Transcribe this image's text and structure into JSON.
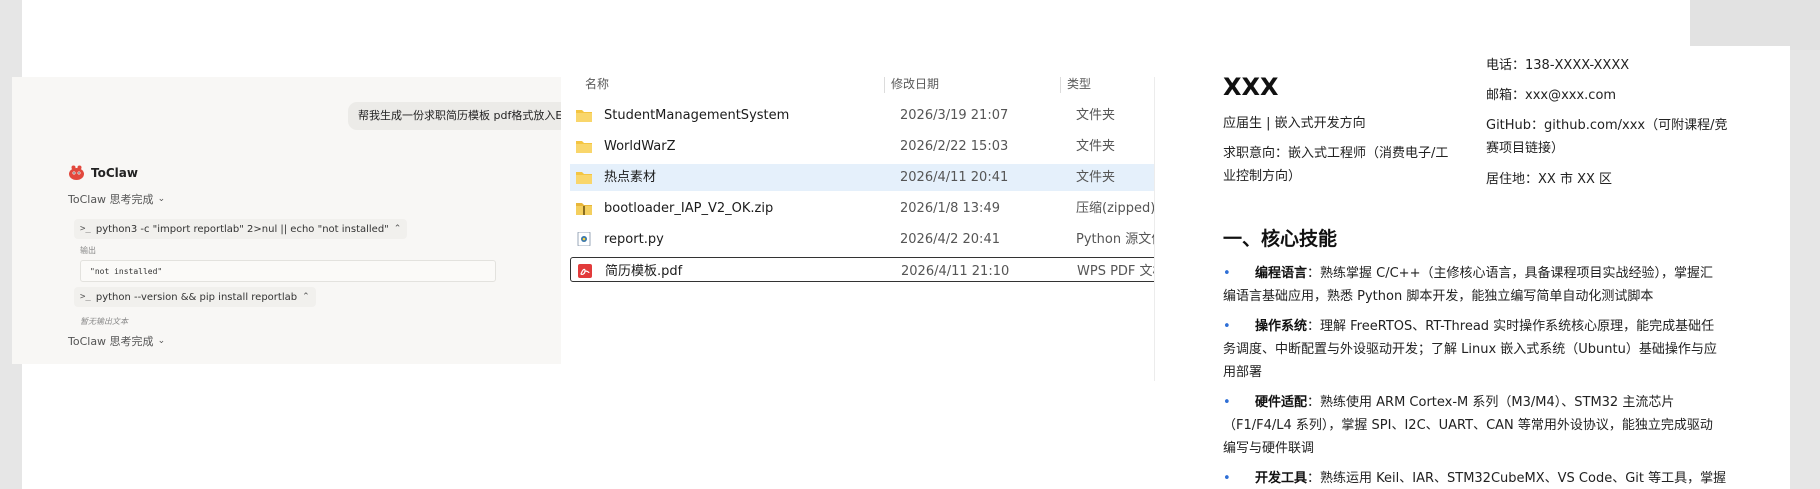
{
  "chat": {
    "user_message": "帮我生成一份求职简历模板 pdf格式放入E盘",
    "bot_name": "ToClaw",
    "think_done_1": "ToClaw 思考完成",
    "cmd1": "python3 -c \"import reportlab\" 2>nul || echo \"not installed\"",
    "output_label": "输出",
    "output_value": "\"not installed\"",
    "cmd2": "python --version && pip install reportlab",
    "no_output": "暂无输出文本",
    "think_done_2": "ToClaw 思考完成"
  },
  "explorer": {
    "headers": {
      "name": "名称",
      "date": "修改日期",
      "type": "类型"
    },
    "rows": [
      {
        "name": "StudentManagementSystem",
        "date": "2026/3/19 21:07",
        "type": "文件夹",
        "icon": "folder-icon"
      },
      {
        "name": "WorldWarZ",
        "date": "2026/2/22 15:03",
        "type": "文件夹",
        "icon": "folder-icon"
      },
      {
        "name": "热点素材",
        "date": "2026/4/11 20:41",
        "type": "文件夹",
        "icon": "folder-icon"
      },
      {
        "name": "bootloader_IAP_V2_OK.zip",
        "date": "2026/1/8 13:49",
        "type": "压缩(zipped)文",
        "icon": "zip-folder-icon"
      },
      {
        "name": "report.py",
        "date": "2026/4/2 20:41",
        "type": "Python 源文件",
        "icon": "python-file-icon"
      },
      {
        "name": "简历模板.pdf",
        "date": "2026/4/11 21:10",
        "type": "WPS PDF 文档",
        "icon": "pdf-file-icon"
      }
    ]
  },
  "resume": {
    "name": "XXX",
    "status": "应届生 | 嵌入式开发方向",
    "intent_line1": "求职意向：嵌入式工程师（消费电子/工",
    "intent_line2": "业控制方向）",
    "phone": "电话：138-XXXX-XXXX",
    "email": "邮箱：xxx@xxx.com",
    "github_line1": "GitHub：github.com/xxx（可附课程/竞",
    "github_line2": "赛项目链接）",
    "location": "居住地：XX 市 XX 区",
    "section_title": "一、核心技能",
    "skills": [
      {
        "title": "编程语言",
        "line1": "：熟练掌握 C/C++（主修核心语言，具备课程项目实战经验），掌握汇",
        "line2": "编语言基础应用，熟悉 Python 脚本开发，能独立编写简单自动化测试脚本",
        "line3": ""
      },
      {
        "title": "操作系统",
        "line1": "：理解 FreeRTOS、RT-Thread 实时操作系统核心原理，能完成基础任",
        "line2": "务调度、中断配置与外设驱动开发；了解 Linux 嵌入式系统（Ubuntu）基础操作与应",
        "line3": "用部署"
      },
      {
        "title": "硬件适配",
        "line1": "：熟练使用 ARM Cortex-M 系列（M3/M4）、STM32 主流芯片",
        "line2": "（F1/F4/L4 系列），掌握 SPI、I2C、UART、CAN 等常用外设协议，能独立完成驱动",
        "line3": "编写与硬件联调"
      },
      {
        "title": "开发工具",
        "line1": "：熟练运用 Keil、IAR、STM32CubeMX、VS Code、Git 等工具，掌握",
        "line2": "",
        "line3": ""
      }
    ]
  },
  "colors": {
    "accent_blue": "#2f6fd6",
    "selection": "#e5f0fb",
    "folder": "#f4c542"
  }
}
